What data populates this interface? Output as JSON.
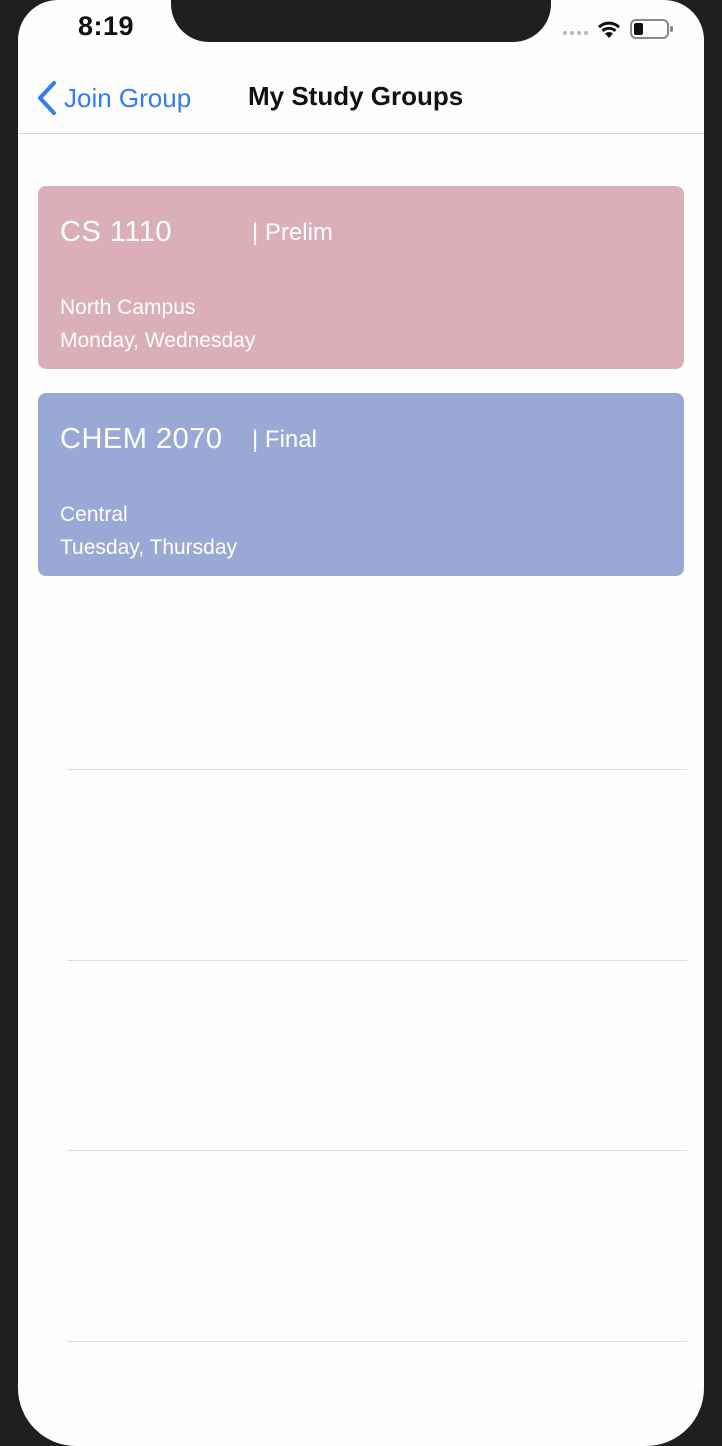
{
  "status_bar": {
    "time": "8:19",
    "icons": [
      "signal-dots-icon",
      "wifi-icon",
      "battery-icon"
    ]
  },
  "nav": {
    "back_label": "Join Group",
    "title": "My Study Groups"
  },
  "groups": [
    {
      "course": "CS 1110",
      "exam": "| Prelim",
      "location": "North Campus",
      "days": "Monday, Wednesday",
      "color": "#dbafba"
    },
    {
      "course": "CHEM 2070",
      "exam": "| Final",
      "location": "Central",
      "days": "Tuesday, Thursday",
      "color": "#99a8d4"
    }
  ],
  "colors": {
    "accent": "#2e7cf6",
    "bezel": "#1f1f1f",
    "screen": "#fefefe"
  }
}
